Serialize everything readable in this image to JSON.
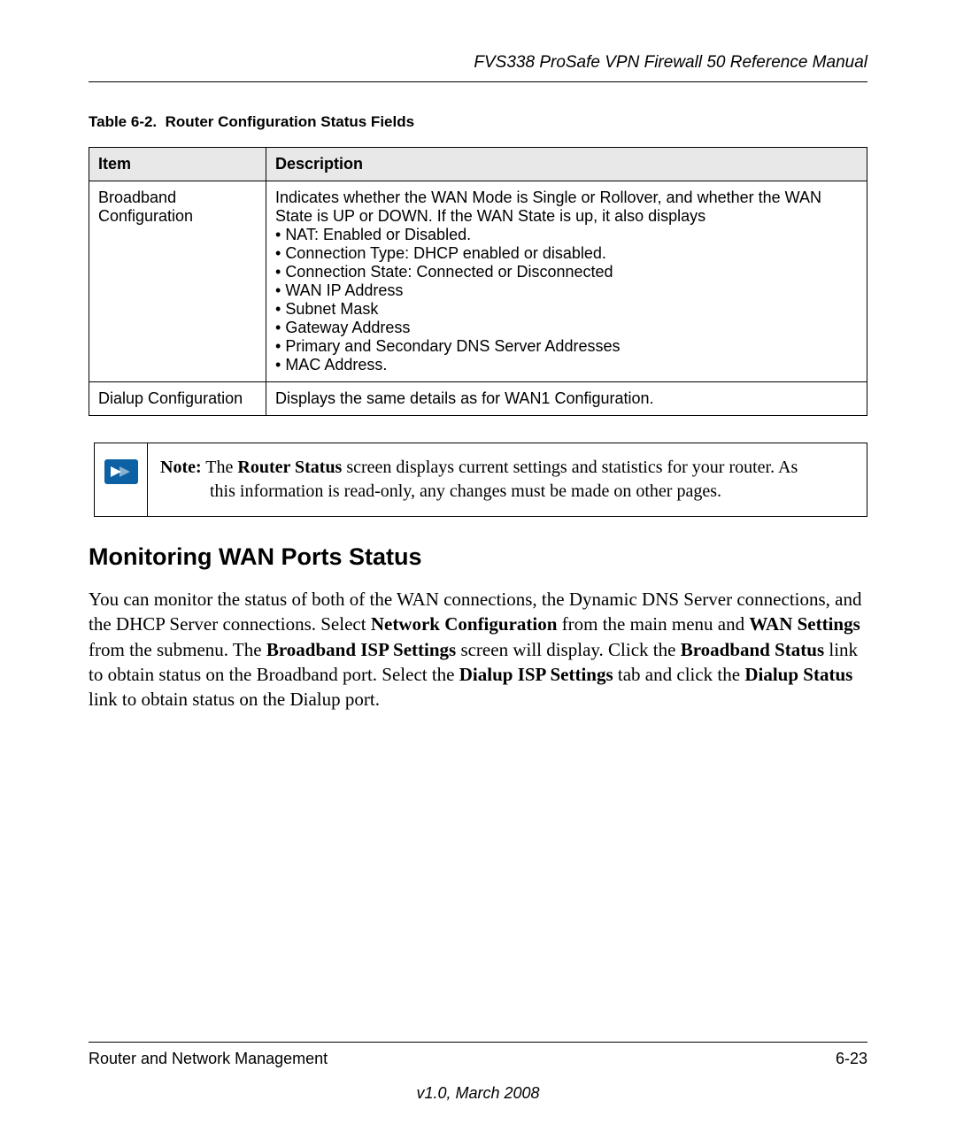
{
  "header": {
    "title": "FVS338 ProSafe VPN Firewall 50 Reference Manual"
  },
  "table": {
    "caption_prefix": "Table 6-2.",
    "caption_title": "Router Configuration Status Fields",
    "columns": {
      "item": "Item",
      "description": "Description"
    },
    "rows": [
      {
        "item": "Broadband Configuration",
        "desc_intro": "Indicates whether the WAN Mode is Single or Rollover, and whether the WAN State is UP or DOWN. If the WAN State is up, it also displays",
        "bullets": [
          "NAT: Enabled or Disabled.",
          "Connection Type: DHCP enabled or disabled.",
          "Connection State: Connected or Disconnected",
          "WAN IP Address",
          "Subnet Mask",
          "Gateway Address",
          "Primary and Secondary DNS Server Addresses",
          "MAC Address."
        ]
      },
      {
        "item": "Dialup Configuration",
        "desc_intro": "Displays the same details as for WAN1 Configuration."
      }
    ]
  },
  "note": {
    "label": "Note:",
    "text_part1": " The ",
    "bold1": "Router Status",
    "text_part2": " screen displays current settings and statistics for your router. As",
    "text_line2": "this information is read-only, any changes must be made on other pages."
  },
  "section": {
    "heading": "Monitoring WAN Ports Status",
    "para": {
      "p0": "You can monitor the status of both of the WAN connections, the Dynamic DNS Server connections, and the DHCP Server connections. Select ",
      "b1": "Network Configuration",
      "p1": " from the main menu and ",
      "b2": "WAN Settings",
      "p2": " from the submenu. The ",
      "b3": "Broadband ISP Settings",
      "p3": " screen will display. Click the ",
      "b4": "Broadband Status",
      "p4": " link to obtain status on the Broadband port. Select the ",
      "b5": "Dialup ISP Settings",
      "p5": " tab and click the ",
      "b6": "Dialup Status",
      "p6": " link to obtain status on the Dialup port."
    }
  },
  "footer": {
    "chapter": "Router and Network Management",
    "page": "6-23",
    "version": "v1.0, March 2008"
  }
}
